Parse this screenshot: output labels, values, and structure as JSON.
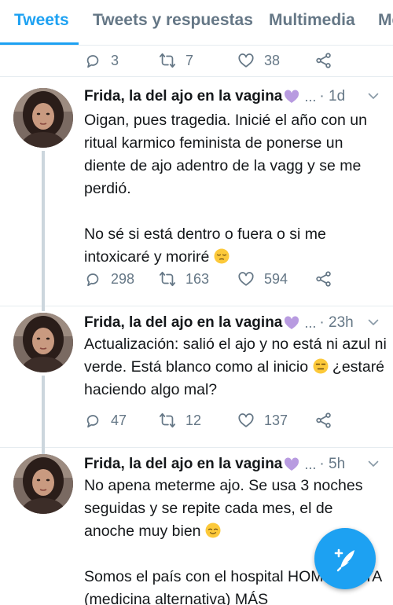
{
  "tabs": [
    "Tweets",
    "Tweets y respuestas",
    "Multimedia",
    "Me"
  ],
  "previous_tweet": {
    "replies": "3",
    "retweets": "7",
    "likes": "38"
  },
  "tweets": [
    {
      "name": "Frida, la del ajo en la vagina",
      "more": "...",
      "time": "· 1d",
      "paragraphs": [
        "Oigan, pues tragedia. Inicié el año con un ritual karmico feminista de ponerse un diente de ajo adentro de la vagg y se me perdió.",
        "No sé si está dentro o fuera o si me intoxicaré y moriré"
      ],
      "replies": "298",
      "retweets": "163",
      "likes": "594"
    },
    {
      "name": "Frida, la del ajo en la vagina",
      "more": "...",
      "time": "· 23h",
      "text_a": "Actualización: salió el ajo y no está ni azul ni verde. Está blanco como al inicio",
      "text_b": "¿estaré haciendo algo mal?",
      "replies": "47",
      "retweets": "12",
      "likes": "137"
    },
    {
      "name": "Frida, la del ajo en la vagina",
      "more": "...",
      "time": "· 5h",
      "paragraphs": [
        "No apena meterme ajo. Se usa 3 noches seguidas y se repite cada mes, el de anoche muy bien",
        "Somos el país con el hospital HOMEÓPATA (medicina alternativa) MÁS"
      ]
    }
  ],
  "colors": {
    "accent": "#1da1f2",
    "muted": "#657786",
    "text": "#14171a",
    "emoji_heart": "#b89be0"
  },
  "icons": [
    "reply-icon",
    "retweet-icon",
    "like-icon",
    "share-icon",
    "compose-icon"
  ]
}
